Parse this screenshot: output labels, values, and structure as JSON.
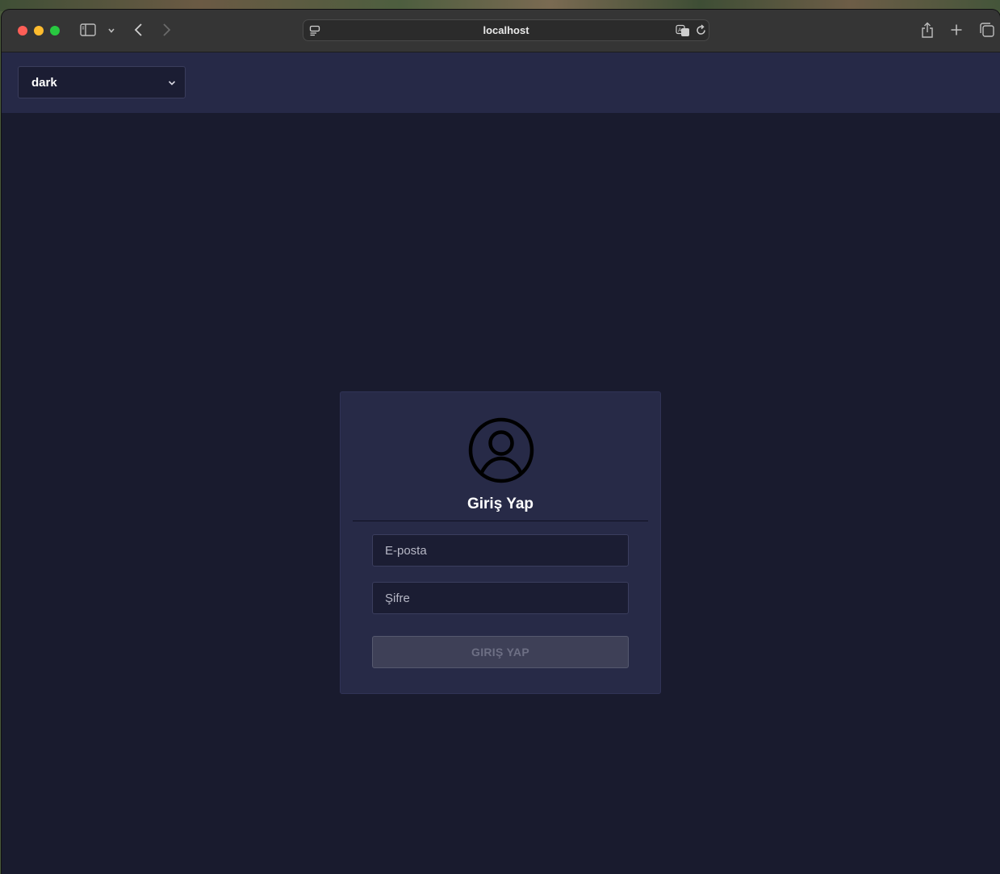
{
  "browser": {
    "url": "localhost",
    "icons": {
      "sidebar": "sidebar-icon",
      "tab_group": "chevron-down-icon",
      "back": "chevron-left-icon",
      "forward": "chevron-right-icon",
      "page_settings": "page-settings-icon",
      "translate": "translate-icon",
      "reload": "reload-icon",
      "share": "share-icon",
      "new_tab": "plus-icon",
      "tabs_overview": "tabs-icon"
    }
  },
  "app": {
    "theme_select": {
      "value": "dark"
    },
    "login": {
      "title": "Giriş Yap",
      "email_placeholder": "E-posta",
      "password_placeholder": "Şifre",
      "submit_label": "GIRIŞ YAP"
    }
  },
  "colors": {
    "page_background": "#191b2e",
    "appbar_background": "#262947",
    "card_background": "#272a47",
    "input_background": "#1b1d33",
    "button_disabled_background": "#3e4057",
    "button_disabled_text": "#6d6f84"
  }
}
